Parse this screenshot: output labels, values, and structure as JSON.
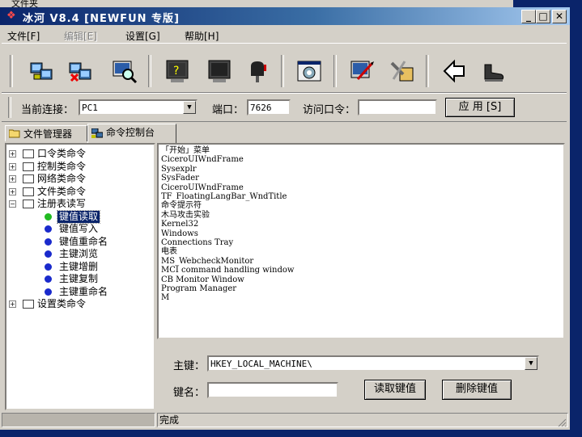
{
  "window": {
    "title": "冰河 V8.4 [NEWFUN 专版]",
    "minimize": "_",
    "maximize": "□",
    "close": "✕"
  },
  "menu": [
    {
      "label": "文件[F]",
      "enabled": true
    },
    {
      "label": "编辑[E]",
      "enabled": false
    },
    {
      "label": "设置[G]",
      "enabled": true
    },
    {
      "label": "帮助[H]",
      "enabled": true
    }
  ],
  "toolbar": {
    "icons": [
      "add-host-icon",
      "remove-host-icon",
      "search-host-icon",
      "help-icon",
      "monitor-icon",
      "mailbox-icon",
      "settings-icon",
      "edit-icon",
      "tools-icon",
      "back-icon",
      "exit-icon"
    ]
  },
  "connection": {
    "current_label": "当前连接：",
    "current_value": "PC1",
    "port_label": "端口：",
    "port_value": "7626",
    "password_label": "访问口令：",
    "password_value": "",
    "apply_label": "应 用 [S]"
  },
  "tabs": [
    {
      "label": "文件管理器",
      "active": false
    },
    {
      "label": "命令控制台",
      "active": true
    }
  ],
  "tree": {
    "groups": [
      {
        "label": "口令类命令",
        "expanded": false
      },
      {
        "label": "控制类命令",
        "expanded": false
      },
      {
        "label": "网络类命令",
        "expanded": false
      },
      {
        "label": "文件类命令",
        "expanded": false
      },
      {
        "label": "注册表读写",
        "expanded": true
      }
    ],
    "children": [
      {
        "label": "键值读取",
        "selected": true
      },
      {
        "label": "键值写入",
        "selected": false
      },
      {
        "label": "键值重命名",
        "selected": false
      },
      {
        "label": "主键浏览",
        "selected": false
      },
      {
        "label": "主键增删",
        "selected": false
      },
      {
        "label": "主键复制",
        "selected": false
      },
      {
        "label": "主键重命名",
        "selected": false
      }
    ],
    "last_group": {
      "label": "设置类命令",
      "expanded": false
    }
  },
  "output_lines": [
    "「开始」菜单",
    "CiceroUIWndFrame",
    "Sysexplr",
    "SysFader",
    "CiceroUIWndFrame",
    "TF_FloatingLangBar_WndTitle",
    "命令提示符",
    "木马攻击实验",
    "Kernel32",
    "Windows",
    "Connections Tray",
    "电表",
    "MS_WebcheckMonitor",
    "MCI command handling window",
    "CB Monitor Window",
    "Program Manager",
    "M"
  ],
  "registry": {
    "key_label": "主键：",
    "key_value": "HKEY_LOCAL_MACHINE\\",
    "name_label": "键名：",
    "name_value": "",
    "read_button": "读取键值",
    "delete_button": "删除键值"
  },
  "status": {
    "left": "",
    "text": "完成"
  },
  "colors": {
    "titlebar_start": "#0a246a",
    "titlebar_end": "#a6caf0",
    "selection": "#0a246a",
    "face": "#d4d0c8",
    "dot_active": "#22bb22",
    "dot_idle": "#1a2acc"
  },
  "background_strip": "文件夹"
}
